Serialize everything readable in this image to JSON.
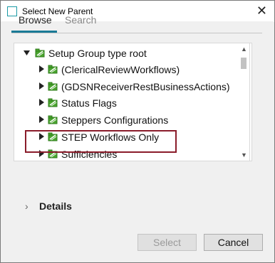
{
  "window": {
    "title": "Select New Parent",
    "close_glyph": "✕"
  },
  "tabs": [
    {
      "label": "Browse",
      "active": true
    },
    {
      "label": "Search",
      "active": false
    }
  ],
  "tree": {
    "root": {
      "label": "Setup Group type root",
      "expanded": true
    },
    "children": [
      {
        "label": "(ClericalReviewWorkflows)"
      },
      {
        "label": "(GDSNReceiverRestBusinessActions)"
      },
      {
        "label": "Status Flags"
      },
      {
        "label": "Steppers Configurations",
        "highlighted": true
      },
      {
        "label": "STEP Workflows Only"
      },
      {
        "label": "Sufficiencies"
      }
    ]
  },
  "details": {
    "label": "Details",
    "chevron": "›"
  },
  "buttons": {
    "select_label": "Select",
    "cancel_label": "Cancel"
  },
  "colors": {
    "accent": "#1a7a96",
    "highlight": "#8a1c2a",
    "icon_green": "#4aa52e"
  }
}
